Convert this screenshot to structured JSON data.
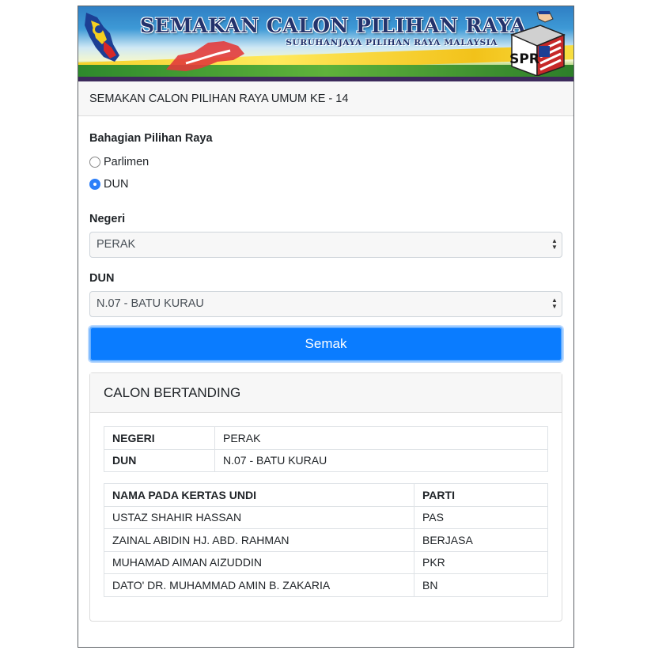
{
  "banner": {
    "title": "SEMAKAN CALON PILIHAN RAYA",
    "subtitle": "SURUHANJAYA PILIHAN RAYA MALAYSIA",
    "logo_text": "SPR"
  },
  "header": {
    "title": "SEMAKAN CALON PILIHAN RAYA UMUM KE - 14"
  },
  "form": {
    "bahagian_label": "Bahagian Pilihan Raya",
    "options": [
      {
        "label": "Parlimen",
        "checked": false
      },
      {
        "label": "DUN",
        "checked": true
      }
    ],
    "negeri_label": "Negeri",
    "negeri_value": "PERAK",
    "dun_label": "DUN",
    "dun_value": "N.07 - BATU KURAU",
    "submit_label": "Semak"
  },
  "result": {
    "title": "CALON BERTANDING",
    "info": [
      {
        "key": "NEGERI",
        "value": "PERAK"
      },
      {
        "key": "DUN",
        "value": "N.07 - BATU KURAU"
      }
    ],
    "columns": [
      "NAMA PADA KERTAS UNDI",
      "PARTI"
    ],
    "candidates": [
      {
        "name": "USTAZ SHAHIR HASSAN",
        "party": "PAS"
      },
      {
        "name": "ZAINAL ABIDIN HJ. ABD. RAHMAN",
        "party": "BERJASA"
      },
      {
        "name": "MUHAMAD AIMAN AIZUDDIN",
        "party": "PKR"
      },
      {
        "name": "DATO' DR. MUHAMMAD AMIN B. ZAKARIA",
        "party": "BN"
      }
    ]
  },
  "colors": {
    "primary": "#0a7cff",
    "banner_title": "#23336c",
    "header_bg": "#f7f7f7"
  }
}
